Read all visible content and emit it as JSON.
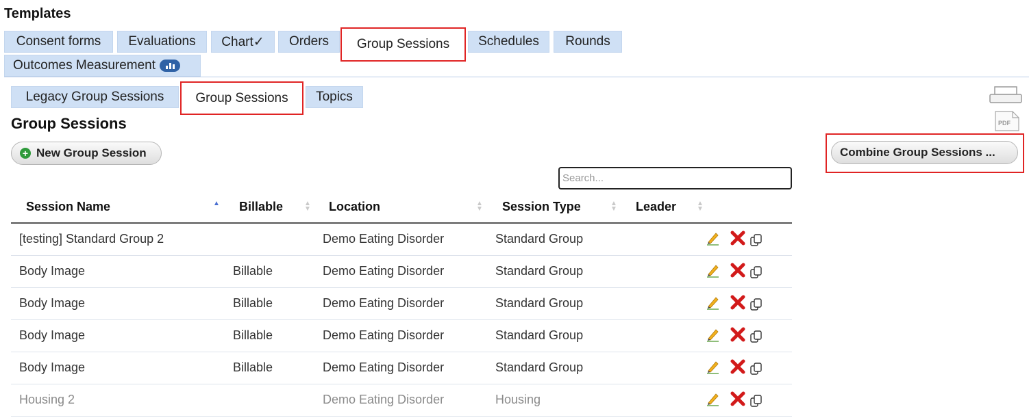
{
  "page": {
    "title": "Templates"
  },
  "main_tabs": [
    {
      "label": "Consent forms"
    },
    {
      "label": "Evaluations"
    },
    {
      "label": "Chart✓"
    },
    {
      "label": "Orders"
    },
    {
      "label": "Group Sessions"
    },
    {
      "label": "Schedules"
    },
    {
      "label": "Rounds"
    },
    {
      "label": "Outcomes Measurement"
    }
  ],
  "sub_tabs": [
    {
      "label": "Legacy Group Sessions"
    },
    {
      "label": "Group Sessions"
    },
    {
      "label": "Topics"
    }
  ],
  "section": {
    "title": "Group Sessions",
    "new_button_label": "New Group Session",
    "combine_button_label": "Combine Group Sessions ...",
    "pdf_label": "PDF"
  },
  "search": {
    "placeholder": "Search..."
  },
  "table": {
    "columns": [
      "Session Name",
      "Billable",
      "Location",
      "Session Type",
      "Leader"
    ],
    "rows": [
      {
        "name": "[testing] Standard Group 2",
        "billable": "",
        "location": "Demo Eating Disorder",
        "type": "Standard Group",
        "leader": ""
      },
      {
        "name": "Body Image",
        "billable": "Billable",
        "location": "Demo Eating Disorder",
        "type": "Standard Group",
        "leader": ""
      },
      {
        "name": "Body Image",
        "billable": "Billable",
        "location": "Demo Eating Disorder",
        "type": "Standard Group",
        "leader": ""
      },
      {
        "name": "Body Image",
        "billable": "Billable",
        "location": "Demo Eating Disorder",
        "type": "Standard Group",
        "leader": ""
      },
      {
        "name": "Body Image",
        "billable": "Billable",
        "location": "Demo Eating Disorder",
        "type": "Standard Group",
        "leader": ""
      },
      {
        "name": "Housing 2",
        "billable": "",
        "location": "Demo Eating Disorder",
        "type": "Housing",
        "leader": ""
      }
    ]
  },
  "colors": {
    "tab_bg": "#cfe0f5",
    "highlight": "#e02424",
    "delete": "#d21a1a",
    "add": "#2e9a3a"
  }
}
